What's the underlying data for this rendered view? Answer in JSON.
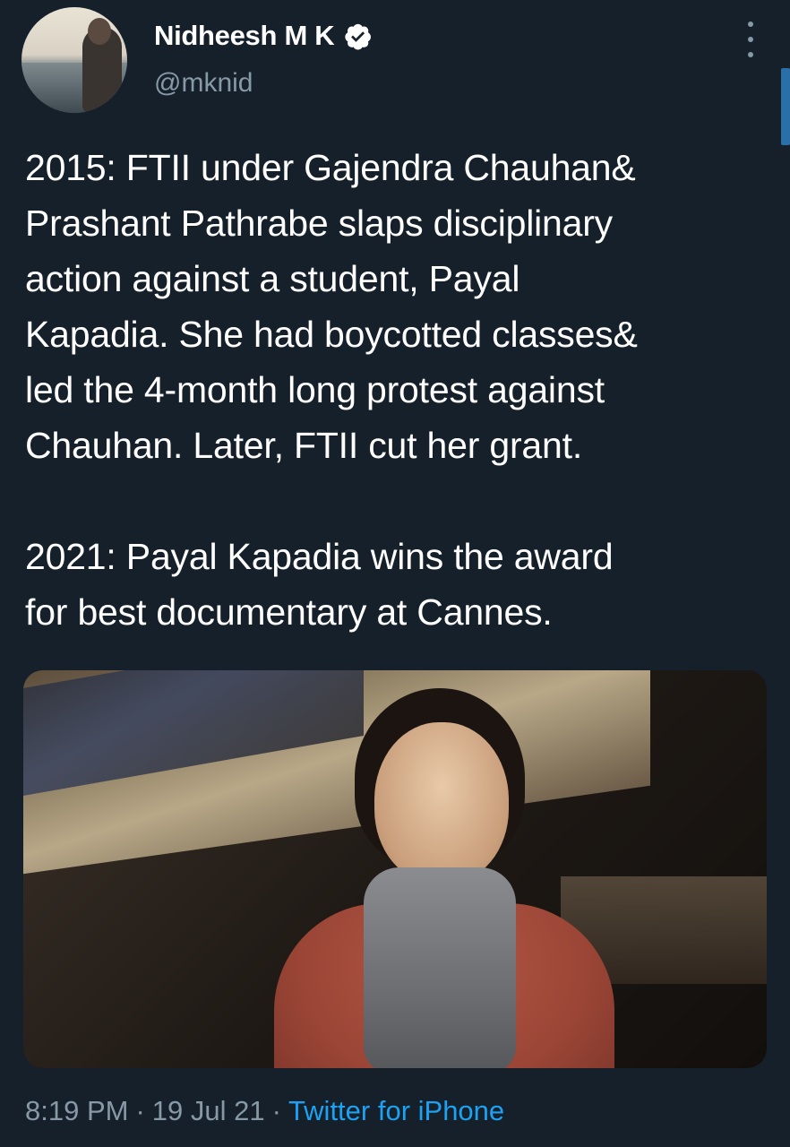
{
  "author": {
    "name": "Nidheesh M K",
    "handle": "@mknid",
    "verified": true
  },
  "tweet": {
    "text": "2015: FTII under Gajendra Chauhan&\nPrashant Pathrabe slaps disciplinary\naction against a student, Payal\nKapadia. She had boycotted classes&\nled the 4-month long protest against\nChauhan. Later, FTII cut her grant.\n\n2021: Payal Kapadia wins the award\nfor best documentary at Cannes."
  },
  "meta": {
    "time": "8:19 PM",
    "sep1": "·",
    "date": "19 Jul 21",
    "sep2": "·",
    "source": "Twitter for iPhone"
  },
  "icons": {
    "verified": "verified-badge-icon",
    "more": "more-vertical-icon"
  },
  "colors": {
    "background": "#15202b",
    "text_secondary": "#8899a6",
    "link": "#1da1f2",
    "verified_fill": "#ffffff"
  }
}
